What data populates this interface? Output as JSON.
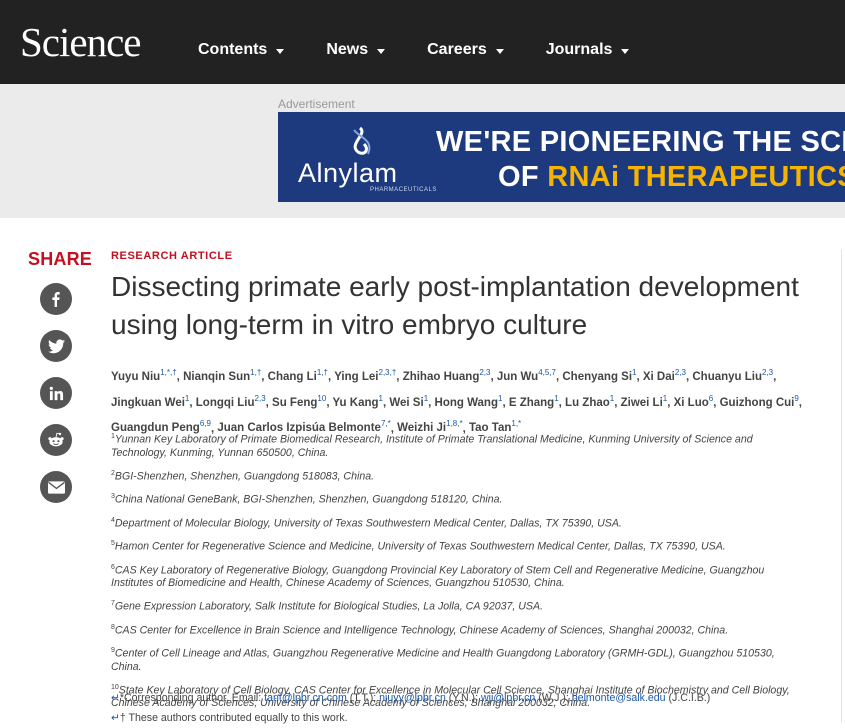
{
  "nav": {
    "logo": "Science",
    "items": [
      {
        "label": "Contents"
      },
      {
        "label": "News"
      },
      {
        "label": "Careers"
      },
      {
        "label": "Journals"
      }
    ]
  },
  "ad": {
    "label": "Advertisement",
    "brand": "Alnylam",
    "brand_sub": "PHARMACEUTICALS",
    "line1": "WE'RE PIONEERING THE SCIE",
    "line2_prefix": "OF ",
    "line2_accent": "RNAi THERAPEUTICS",
    "colors": {
      "background": "#1d3a7e",
      "accent": "#f6b300"
    }
  },
  "share": {
    "title": "SHARE",
    "buttons": [
      {
        "icon": "facebook-icon"
      },
      {
        "icon": "twitter-icon"
      },
      {
        "icon": "linkedin-icon"
      },
      {
        "icon": "reddit-icon"
      },
      {
        "icon": "email-icon"
      }
    ]
  },
  "article": {
    "kicker": "RESEARCH ARTICLE",
    "title": "Dissecting primate early post-implantation development using long-term in vitro embryo culture",
    "authors": [
      {
        "name": "Yuyu Niu",
        "sup": "1,*,†"
      },
      {
        "name": "Nianqin Sun",
        "sup": "1,†"
      },
      {
        "name": "Chang Li",
        "sup": "1,†"
      },
      {
        "name": "Ying Lei",
        "sup": "2,3,†"
      },
      {
        "name": "Zhihao Huang",
        "sup": "2,3"
      },
      {
        "name": "Jun Wu",
        "sup": "4,5,7"
      },
      {
        "name": "Chenyang Si",
        "sup": "1"
      },
      {
        "name": "Xi Dai",
        "sup": "2,3"
      },
      {
        "name": "Chuanyu Liu",
        "sup": "2,3"
      },
      {
        "name": "Jingkuan Wei",
        "sup": "1"
      },
      {
        "name": "Longqi Liu",
        "sup": "2,3"
      },
      {
        "name": "Su Feng",
        "sup": "10"
      },
      {
        "name": "Yu Kang",
        "sup": "1"
      },
      {
        "name": "Wei Si",
        "sup": "1"
      },
      {
        "name": "Hong Wang",
        "sup": "1"
      },
      {
        "name": "E Zhang",
        "sup": "1"
      },
      {
        "name": "Lu Zhao",
        "sup": "1"
      },
      {
        "name": "Ziwei Li",
        "sup": "1"
      },
      {
        "name": "Xi Luo",
        "sup": "6"
      },
      {
        "name": "Guizhong Cui",
        "sup": "9"
      },
      {
        "name": "Guangdun Peng",
        "sup": "6,9"
      },
      {
        "name": "Juan Carlos Izpisúa Belmonte",
        "sup": "7,*"
      },
      {
        "name": "Weizhi Ji",
        "sup": "1,8,*"
      },
      {
        "name": "Tao Tan",
        "sup": "1,*"
      }
    ],
    "affiliations": [
      {
        "num": "1",
        "text": "Yunnan Key Laboratory of Primate Biomedical Research, Institute of Primate Translational Medicine, Kunming University of Science and Technology, Kunming, Yunnan 650500, China."
      },
      {
        "num": "2",
        "text": "BGI-Shenzhen, Shenzhen, Guangdong 518083, China."
      },
      {
        "num": "3",
        "text": "China National GeneBank, BGI-Shenzhen, Shenzhen, Guangdong 518120, China."
      },
      {
        "num": "4",
        "text": "Department of Molecular Biology, University of Texas Southwestern Medical Center, Dallas, TX 75390, USA."
      },
      {
        "num": "5",
        "text": "Hamon Center for Regenerative Science and Medicine, University of Texas Southwestern Medical Center, Dallas, TX 75390, USA."
      },
      {
        "num": "6",
        "text": "CAS Key Laboratory of Regenerative Biology, Guangdong Provincial Key Laboratory of Stem Cell and Regenerative Medicine, Guangzhou Institutes of Biomedicine and Health, Chinese Academy of Sciences, Guangzhou 510530, China."
      },
      {
        "num": "7",
        "text": "Gene Expression Laboratory, Salk Institute for Biological Studies, La Jolla, CA 92037, USA."
      },
      {
        "num": "8",
        "text": "CAS Center for Excellence in Brain Science and Intelligence Technology, Chinese Academy of Sciences, Shanghai 200032, China."
      },
      {
        "num": "9",
        "text": "Center of Cell Lineage and Atlas, Guangzhou Regenerative Medicine and Health Guangdong Laboratory (GRMH-GDL), Guangzhou 510530, China."
      },
      {
        "num": "10",
        "text": "State Key Laboratory of Cell Biology, CAS Center for Excellence in Molecular Cell Science, Shanghai Institute of Biochemistry and Cell Biology, Chinese Academy of Sciences; University of Chinese Academy of Sciences, Shanghai 200032, China."
      }
    ],
    "corresponding": {
      "back": "↵",
      "prefix": "*Corresponding author. Email: ",
      "emails": [
        {
          "email": "tant@lpbr.cn.com",
          "who": " (T.T.); "
        },
        {
          "email": "niuyy@lpbr.cn",
          "who": " (Y.N.); "
        },
        {
          "email": "wji@lpbr.cn",
          "who": " (W.J.); "
        },
        {
          "email": "belmonte@salk.edu",
          "who": " (J.C.I.B.)"
        }
      ]
    },
    "equal_note": {
      "back": "↵",
      "text": "† These authors contributed equally to this work."
    }
  }
}
